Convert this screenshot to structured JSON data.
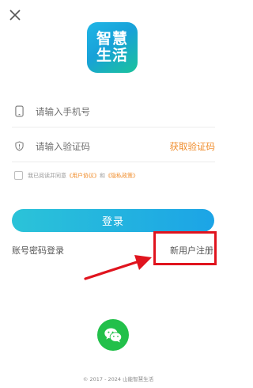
{
  "logo": {
    "line1": "智慧",
    "line2": "生活"
  },
  "phone": {
    "placeholder": "请输入手机号"
  },
  "code": {
    "placeholder": "请输入验证码",
    "get_code_label": "获取验证码"
  },
  "agreement": {
    "prefix": "我已阅读并同意",
    "user_agreement": "《用户协议》",
    "joiner": "和",
    "privacy_policy": "《隐私政策》"
  },
  "login_label": "登录",
  "password_login_label": "账号密码登录",
  "register_label": "新用户注册",
  "footer": "© 2017 - 2024 山能智慧生活",
  "icons": {
    "close": "close-icon",
    "phone": "phone-icon",
    "shield": "shield-icon",
    "wechat": "wechat-icon",
    "arrow": "red-arrow-icon"
  },
  "colors": {
    "accent_orange": "#f08c2a",
    "highlight_red": "#e0141e",
    "wechat_green": "#22c04a",
    "button_gradient_start": "#2bc3d8",
    "button_gradient_end": "#1ca4e6"
  }
}
